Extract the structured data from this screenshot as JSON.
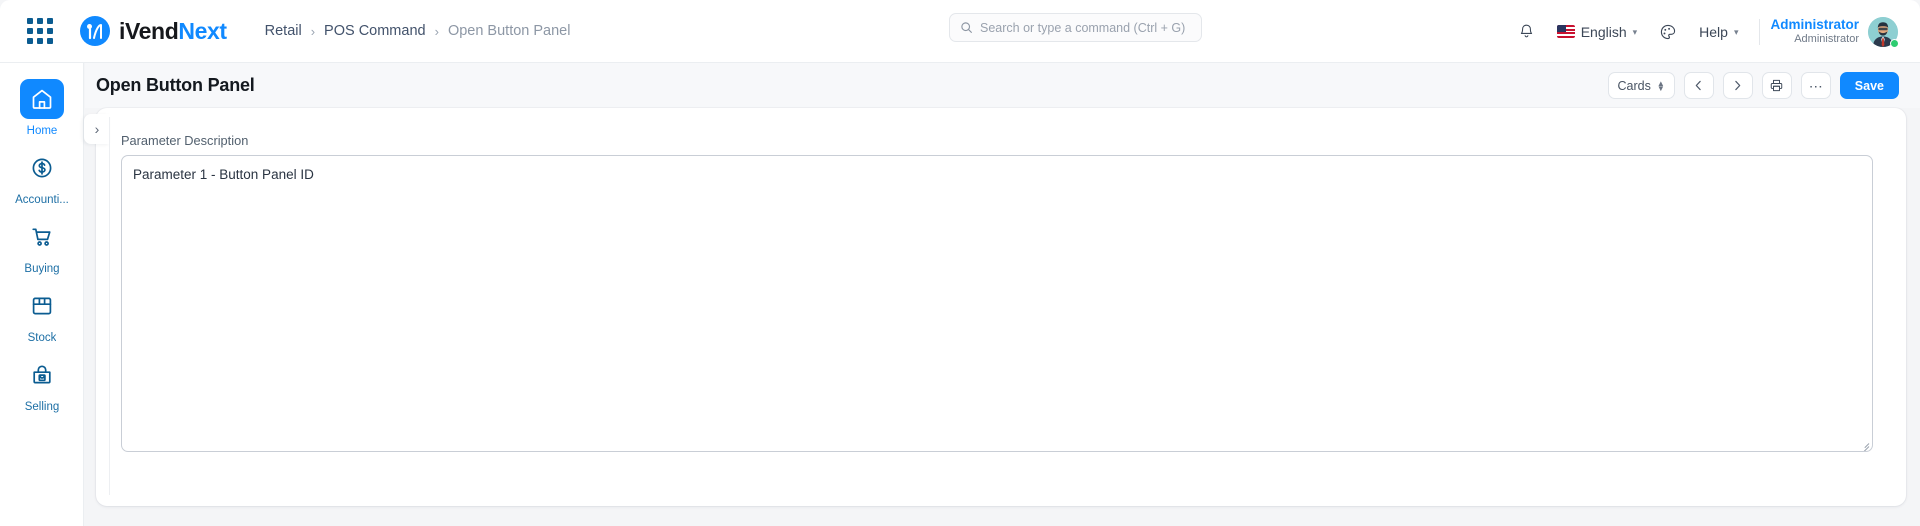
{
  "app": {
    "brand_primary": "iVend",
    "brand_secondary": "Next",
    "accent_color": "#1089ff",
    "nav_icon_color": "#0b5c91"
  },
  "navbar": {
    "apps_icon": "grid-apps-icon",
    "logo_icon": "ivendnext-logo-icon",
    "breadcrumb": [
      {
        "label": "Retail",
        "current": false
      },
      {
        "label": "POS Command",
        "current": false
      },
      {
        "label": "Open Button Panel",
        "current": true
      }
    ],
    "breadcrumb_separator": "›",
    "search": {
      "icon": "search-icon",
      "placeholder": "Search or type a command (Ctrl + G)",
      "value": ""
    },
    "notifications_icon": "bell-icon",
    "language": {
      "flag_icon": "us-flag-icon",
      "label": "English",
      "caret": "∨"
    },
    "theme": {
      "icon": "palette-icon"
    },
    "help": {
      "label": "Help",
      "caret": "∨"
    },
    "user": {
      "name": "Administrator",
      "role": "Administrator",
      "avatar_icon": "user-avatar",
      "status": "online"
    }
  },
  "sidebar": {
    "items": [
      {
        "label": "Home",
        "icon": "home-icon",
        "active": true
      },
      {
        "label": "Accounti...",
        "icon": "dollar-circle-icon",
        "active": false
      },
      {
        "label": "Buying",
        "icon": "shopping-cart-icon",
        "active": false
      },
      {
        "label": "Stock",
        "icon": "box-icon",
        "active": false
      },
      {
        "label": "Selling",
        "icon": "shopping-bag-check-icon",
        "active": false
      }
    ]
  },
  "page": {
    "title": "Open Button Panel",
    "toolbar": {
      "view_selector": {
        "label": "Cards",
        "icon": "stepper-icon"
      },
      "prev": {
        "icon": "chevron-left-icon",
        "label": "‹"
      },
      "next": {
        "icon": "chevron-right-icon",
        "label": "›"
      },
      "print": {
        "icon": "printer-icon"
      },
      "more": {
        "icon": "ellipsis-icon",
        "label": "⋯"
      },
      "save": {
        "label": "Save"
      }
    }
  },
  "form": {
    "collapse_toggle": {
      "icon": "chevron-right-icon",
      "label": "›"
    },
    "fields": [
      {
        "label": "Parameter Description",
        "value": "Parameter 1 - Button Panel ID",
        "type": "textarea"
      }
    ]
  }
}
